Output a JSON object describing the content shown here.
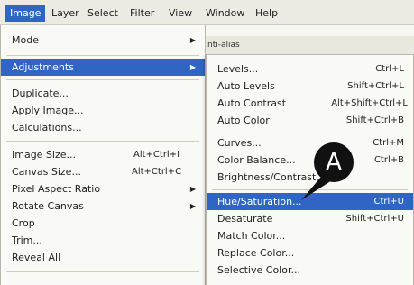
{
  "menubar": {
    "items": [
      "Image",
      "Layer",
      "Select",
      "Filter",
      "View",
      "Window",
      "Help"
    ]
  },
  "optbar": {
    "text": "nti-alias"
  },
  "image_menu": {
    "items": [
      {
        "label": "Mode",
        "shortcut": "",
        "submenu": true
      },
      {
        "label": "Adjustments",
        "shortcut": "",
        "submenu": true,
        "highlighted": true
      },
      {
        "label": "Duplicate...",
        "shortcut": ""
      },
      {
        "label": "Apply Image...",
        "shortcut": ""
      },
      {
        "label": "Calculations...",
        "shortcut": ""
      },
      {
        "label": "Image Size...",
        "shortcut": "Alt+Ctrl+I"
      },
      {
        "label": "Canvas Size...",
        "shortcut": "Alt+Ctrl+C"
      },
      {
        "label": "Pixel Aspect Ratio",
        "shortcut": "",
        "submenu": true
      },
      {
        "label": "Rotate Canvas",
        "shortcut": "",
        "submenu": true
      },
      {
        "label": "Crop",
        "shortcut": ""
      },
      {
        "label": "Trim...",
        "shortcut": ""
      },
      {
        "label": "Reveal All",
        "shortcut": ""
      }
    ]
  },
  "adjustments_menu": {
    "items": [
      {
        "label": "Levels...",
        "shortcut": "Ctrl+L"
      },
      {
        "label": "Auto Levels",
        "shortcut": "Shift+Ctrl+L"
      },
      {
        "label": "Auto Contrast",
        "shortcut": "Alt+Shift+Ctrl+L"
      },
      {
        "label": "Auto Color",
        "shortcut": "Shift+Ctrl+B"
      },
      {
        "label": "Curves...",
        "shortcut": "Ctrl+M"
      },
      {
        "label": "Color Balance...",
        "shortcut": "Ctrl+B"
      },
      {
        "label": "Brightness/Contrast...",
        "shortcut": ""
      },
      {
        "label": "Hue/Saturation...",
        "shortcut": "Ctrl+U",
        "highlighted": true
      },
      {
        "label": "Desaturate",
        "shortcut": "Shift+Ctrl+U"
      },
      {
        "label": "Match Color...",
        "shortcut": ""
      },
      {
        "label": "Replace Color...",
        "shortcut": ""
      },
      {
        "label": "Selective Color...",
        "shortcut": ""
      }
    ]
  },
  "callout": {
    "label": "A"
  },
  "colors": {
    "highlight": "#3165c4",
    "menu_bg": "#f9f9f6"
  }
}
